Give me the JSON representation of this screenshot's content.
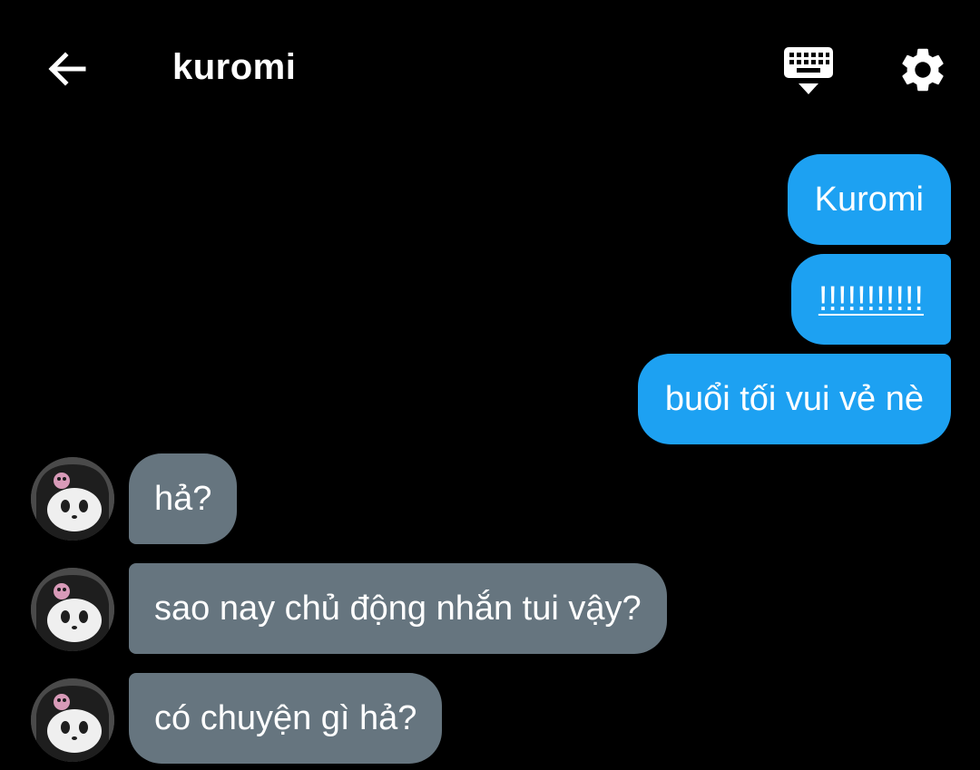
{
  "header": {
    "back_icon": "arrow-left-icon",
    "title": "kuromi",
    "keyboard_icon": "keyboard-hide-icon",
    "settings_icon": "gear-icon"
  },
  "colors": {
    "background": "#000000",
    "sent_bubble": "#1da1f2",
    "received_bubble": "#66757f",
    "text": "#ffffff"
  },
  "messages": {
    "sent": [
      {
        "text": "Kuromi"
      },
      {
        "text": "!!!!!!!!!!!"
      },
      {
        "text": "buổi tối vui vẻ nè"
      }
    ],
    "received": [
      {
        "text": "hả?"
      },
      {
        "text": "sao nay chủ động nhắn tui vậy?"
      },
      {
        "text": "có chuyện gì hả?"
      }
    ]
  }
}
